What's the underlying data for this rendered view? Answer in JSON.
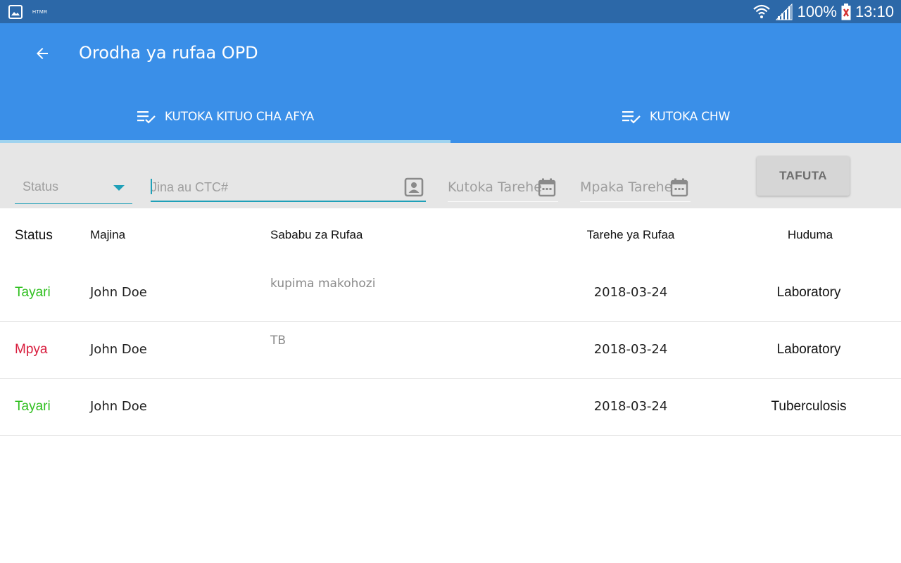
{
  "status_bar": {
    "left_label": "HTMR",
    "battery": "100%",
    "time": "13:10"
  },
  "app_bar": {
    "title": "Orodha ya rufaa OPD",
    "back_icon": "arrow-back-icon"
  },
  "tabs": [
    {
      "label": "KUTOKA KITUO CHA AFYA",
      "icon": "playlist-check-icon",
      "selected": true
    },
    {
      "label": "KUTOKA CHW",
      "icon": "playlist-check-icon",
      "selected": false
    }
  ],
  "filters": {
    "status_placeholder": "Status",
    "name_placeholder": "Jina au CTC#",
    "name_value": "",
    "from_date_placeholder": "Kutoka Tarehe",
    "to_date_placeholder": "Mpaka Tarehe",
    "search_button": "TAFUTA"
  },
  "table": {
    "headers": {
      "status": "Status",
      "name": "Majina",
      "reason": "Sababu za Rufaa",
      "date": "Tarehe ya Rufaa",
      "service": "Huduma"
    },
    "rows": [
      {
        "status": "Tayari",
        "status_color": "#2fbf1f",
        "name": "John Doe",
        "reason": "kupima makohozi",
        "date": "2018-03-24",
        "service": "Laboratory"
      },
      {
        "status": "Mpya",
        "status_color": "#d81b3c",
        "name": "John Doe",
        "reason": "TB",
        "date": "2018-03-24",
        "service": "Laboratory"
      },
      {
        "status": "Tayari",
        "status_color": "#2fbf1f",
        "name": "John Doe",
        "reason": "",
        "date": "2018-03-24",
        "service": "Tuberculosis"
      }
    ]
  },
  "colors": {
    "app_bar": "#3a8fe8",
    "status_bar": "#2c68a8",
    "accent": "#1fa0b8",
    "tab_indicator": "#9fd3ef"
  }
}
